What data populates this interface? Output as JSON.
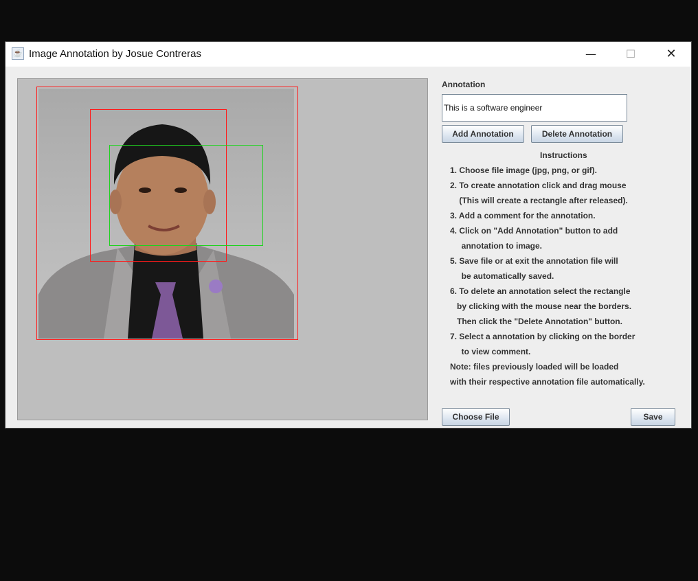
{
  "window": {
    "title": "Image Annotation by Josue Contreras",
    "app_icon": "java-cup-icon",
    "min_glyph": "—",
    "max_glyph": "☐",
    "close_glyph": "✕"
  },
  "image_panel": {
    "image_subject": "portrait photo",
    "annotation_colors": {
      "unselected": "#ff1a1a",
      "selected": "#1fd31f"
    }
  },
  "annotation": {
    "label": "Annotation",
    "value": "This is a software engineer"
  },
  "buttons": {
    "add": "Add Annotation",
    "delete": "Delete Annotation",
    "choose_file": "Choose File",
    "save": "Save"
  },
  "instructions": {
    "title": "Instructions",
    "lines": [
      "1. Choose file image (jpg, png, or gif).",
      "2. To create annotation click and drag mouse",
      "    (This will create a rectangle after released).",
      "3. Add a comment for the annotation.",
      "4. Click on \"Add Annotation\" button to add",
      "     annotation to image.",
      "5. Save file or at exit the annotation file will",
      "     be automatically saved.",
      "6. To delete an annotation select the rectangle",
      "   by clicking with the mouse near the borders.",
      "   Then click the \"Delete Annotation\" button.",
      "7. Select a annotation by clicking on the border",
      "     to view comment.",
      "Note: files previously loaded will be loaded",
      "with their respective annotation file automatically."
    ]
  }
}
